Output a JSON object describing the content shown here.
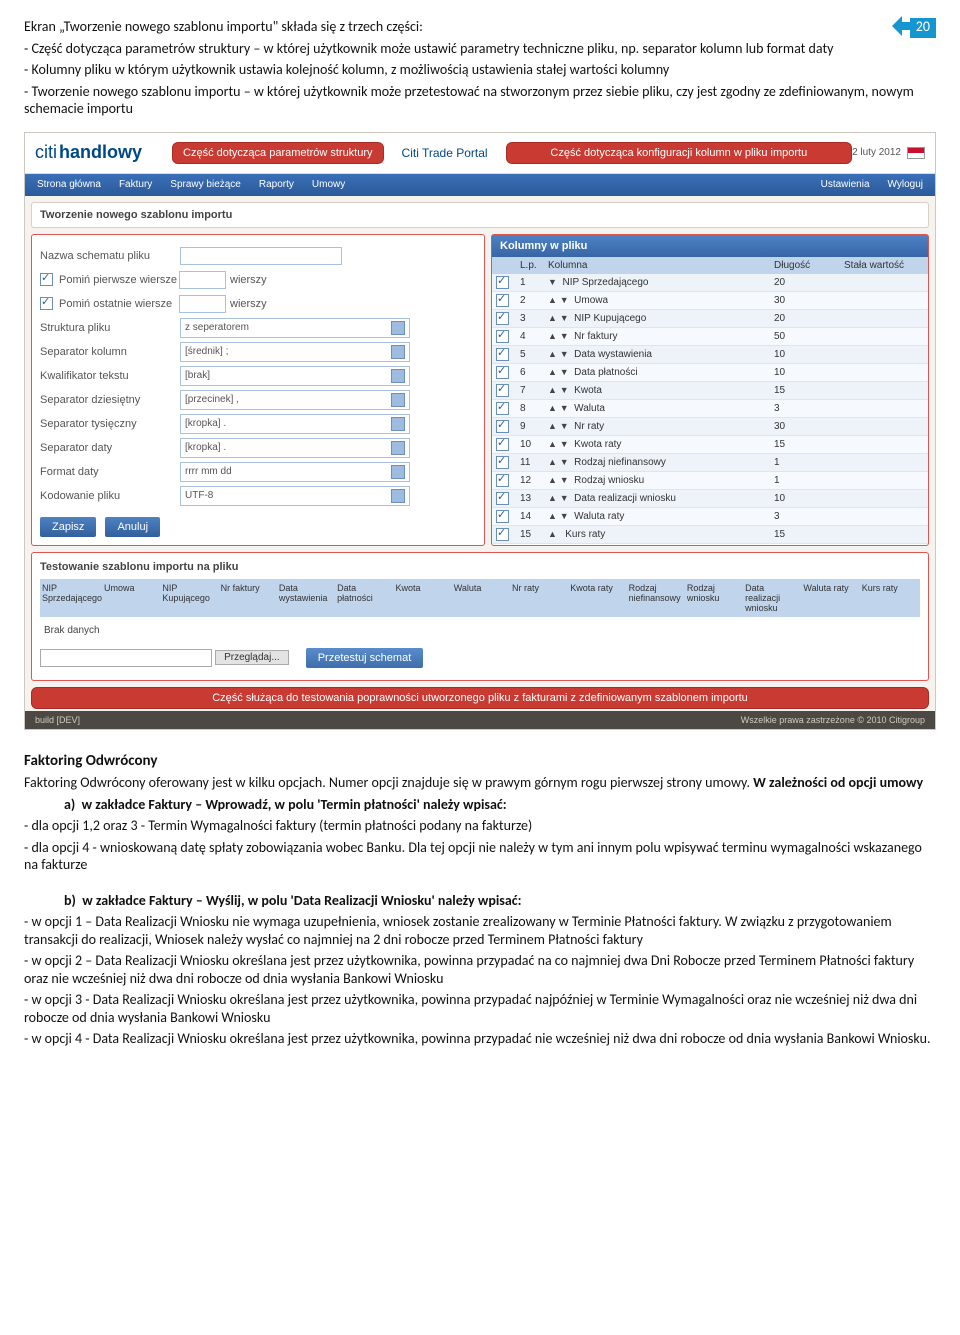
{
  "badge": "20",
  "intro": {
    "p1": "Ekran „Tworzenie nowego szablonu importu\" składa się z trzech części:",
    "p2": "- Część dotycząca parametrów struktury – w której użytkownik może ustawić parametry techniczne pliku, np. separator kolumn lub format daty",
    "p3": "- Kolumny pliku w którym użytkownik ustawia kolejność kolumn, z możliwością ustawienia stałej wartości kolumny",
    "p4": "- Tworzenie nowego szablonu importu – w której użytkownik może przetestować na stworzonym przez siebie pliku, czy jest zgodny ze zdefiniowanym, nowym schemacie importu"
  },
  "shot": {
    "logo1": "citi",
    "logo2": "handlowy",
    "portal": "Citi Trade Portal",
    "date": "2 luty 2012",
    "call1": "Część dotycząca parametrów struktury",
    "call2": "Część dotycząca konfiguracji kolumn w pliku importu",
    "call3": "Część służąca do testowania poprawności utworzonego pliku z fakturami z zdefiniowanym szablonem importu",
    "nav": [
      "Strona główna",
      "Faktury",
      "Sprawy bieżące",
      "Raporty",
      "Umowy",
      "Ustawienia",
      "Wyloguj"
    ],
    "title": "Tworzenie nowego szablonu importu",
    "left": {
      "f1": "Nazwa schematu pliku",
      "f2": "Pomiń pierwsze wiersze",
      "f2u": "wierszy",
      "f3": "Pomiń ostatnie wiersze",
      "f3u": "wierszy",
      "f4": "Struktura pliku",
      "v4": "z seperatorem",
      "f5": "Separator kolumn",
      "v5": "[średnik] ;",
      "f6": "Kwalifikator tekstu",
      "v6": "[brak]",
      "f7": "Separator dziesiętny",
      "v7": "[przecinek] ,",
      "f8": "Separator tysięczny",
      "v8": "[kropka] .",
      "f9": "Separator daty",
      "v9": "[kropka] .",
      "f10": "Format daty",
      "v10": "rrrr mm dd",
      "f11": "Kodowanie pliku",
      "v11": "UTF-8",
      "b1": "Zapisz",
      "b2": "Anuluj"
    },
    "right": {
      "head": "Kolumny w pliku",
      "cols": [
        "L.p.",
        "Kolumna",
        "Długość",
        "Stała wartość"
      ],
      "rows": [
        {
          "n": "1",
          "k": "NIP Sprzedającego",
          "d": "20"
        },
        {
          "n": "2",
          "k": "Umowa",
          "d": "30"
        },
        {
          "n": "3",
          "k": "NIP Kupującego",
          "d": "20"
        },
        {
          "n": "4",
          "k": "Nr faktury",
          "d": "50"
        },
        {
          "n": "5",
          "k": "Data wystawienia",
          "d": "10"
        },
        {
          "n": "6",
          "k": "Data płatności",
          "d": "10"
        },
        {
          "n": "7",
          "k": "Kwota",
          "d": "15"
        },
        {
          "n": "8",
          "k": "Waluta",
          "d": "3"
        },
        {
          "n": "9",
          "k": "Nr raty",
          "d": "30"
        },
        {
          "n": "10",
          "k": "Kwota raty",
          "d": "15"
        },
        {
          "n": "11",
          "k": "Rodzaj niefinansowy",
          "d": "1"
        },
        {
          "n": "12",
          "k": "Rodzaj wniosku",
          "d": "1"
        },
        {
          "n": "13",
          "k": "Data realizacji wniosku",
          "d": "10"
        },
        {
          "n": "14",
          "k": "Waluta raty",
          "d": "3"
        },
        {
          "n": "15",
          "k": "Kurs raty",
          "d": "15"
        }
      ]
    },
    "test": {
      "head": "Testowanie szablonu importu na pliku",
      "cols": [
        "NIP Sprzedającego",
        "Umowa",
        "NIP Kupującego",
        "Nr faktury",
        "Data wystawienia",
        "Data płatności",
        "Kwota",
        "Waluta",
        "Nr raty",
        "Kwota raty",
        "Rodzaj niefinansowy",
        "Rodzaj wniosku",
        "Data realizacji wniosku",
        "Waluta raty",
        "Kurs raty"
      ],
      "empty": "Brak danych",
      "browse": "Przeglądaj...",
      "run": "Przetestuj schemat"
    },
    "foot": {
      "l": "build [DEV]",
      "r": "Wszelkie prawa zastrzeżone © 2010 Citigroup"
    }
  },
  "sec1": "Faktoring Odwrócony",
  "sec1p": "Faktoring Odwrócony oferowany jest w kilku opcjach. Numer opcji znajduje się w prawym górnym rogu pierwszej strony umowy. ",
  "sec1b": "W zależności od opcji umowy",
  "a_lbl": "a)",
  "a_txt": "w zakładce Faktury – Wprowadź, w polu 'Termin płatności' należy wpisać:",
  "a1": "- dla opcji 1,2 oraz 3 - Termin Wymagalności faktury (termin płatności podany na fakturze)",
  "a2": "- dla opcji 4 - wnioskowaną datę spłaty zobowiązania wobec Banku. Dla tej opcji nie należy w tym ani innym polu wpisywać terminu wymagalności wskazanego na fakturze",
  "b_lbl": "b)",
  "b_txt": "w zakładce Faktury – Wyślij, w polu 'Data Realizacji Wniosku' należy wpisać:",
  "b1": "- w opcji 1 – Data Realizacji Wniosku nie wymaga uzupełnienia, wniosek zostanie zrealizowany w Terminie Płatności faktury. W związku z przygotowaniem transakcji do realizacji, Wniosek należy wysłać co najmniej na 2 dni robocze przed Terminem Płatności faktury",
  "b2": "- w opcji 2 – Data Realizacji Wniosku określana jest przez użytkownika, powinna przypadać na co najmniej dwa Dni Robocze przed Terminem Płatności faktury oraz nie wcześniej niż dwa dni robocze od dnia wysłania Bankowi Wniosku",
  "b3": "- w opcji 3 - Data Realizacji Wniosku określana jest przez użytkownika,  powinna przypadać najpóźniej w Terminie Wymagalności oraz nie wcześniej niż dwa dni robocze od dnia wysłania Bankowi Wniosku",
  "b4": "- w opcji 4 - Data Realizacji Wniosku określana jest przez użytkownika,  powinna przypadać nie wcześniej niż dwa dni robocze od dnia wysłania Bankowi Wniosku."
}
